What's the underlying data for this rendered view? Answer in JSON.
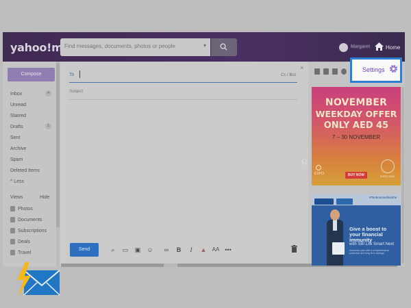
{
  "header": {
    "logo": "yahoo!mail",
    "search_placeholder": "Find messages, documents, photos or people",
    "username": "Margaret",
    "home_label": "Home"
  },
  "sidebar": {
    "compose_label": "Compose",
    "items": [
      {
        "label": "Inbox",
        "badge": "4"
      },
      {
        "label": "Unread",
        "badge": ""
      },
      {
        "label": "Starred",
        "badge": ""
      },
      {
        "label": "Drafts",
        "badge": "1"
      },
      {
        "label": "Sent",
        "badge": ""
      },
      {
        "label": "Archive",
        "badge": ""
      },
      {
        "label": "Spam",
        "badge": ""
      },
      {
        "label": "Deleted Items",
        "badge": ""
      },
      {
        "label": "^ Less",
        "badge": ""
      }
    ],
    "views_label": "Views",
    "hide_label": "Hide",
    "views": [
      "Photos",
      "Documents",
      "Subscriptions",
      "Deals",
      "Travel"
    ]
  },
  "compose": {
    "to_label": "To",
    "cc_bcc": "Cc / Bcc",
    "subject_placeholder": "Subject",
    "send_label": "Send",
    "close": "×"
  },
  "rail": {
    "settings_label": "Settings"
  },
  "ad1": {
    "line1": "NOVEMBER",
    "line2": "WEEKDAY OFFER",
    "line3": "ONLY AED 45",
    "dates": "7 – 30 NOVEMBER",
    "buy": "BUY NOW",
    "expo": "EXPO",
    "expo2": "EXPO 2020"
  },
  "ad2": {
    "tag": "#Tenbosmoefanishe",
    "headline": "Give a boost to your financial immunity",
    "product": "with SBI Life Smart Next",
    "fine": "Insurance plan with a comprehensive protection and long term savings"
  },
  "colors": {
    "header_bg": "#4a2f63",
    "compose_btn": "#8f7fb0",
    "send_btn": "#2f6fc0",
    "settings_highlight": "#2d7fd6",
    "settings_text": "#6d47bd"
  }
}
